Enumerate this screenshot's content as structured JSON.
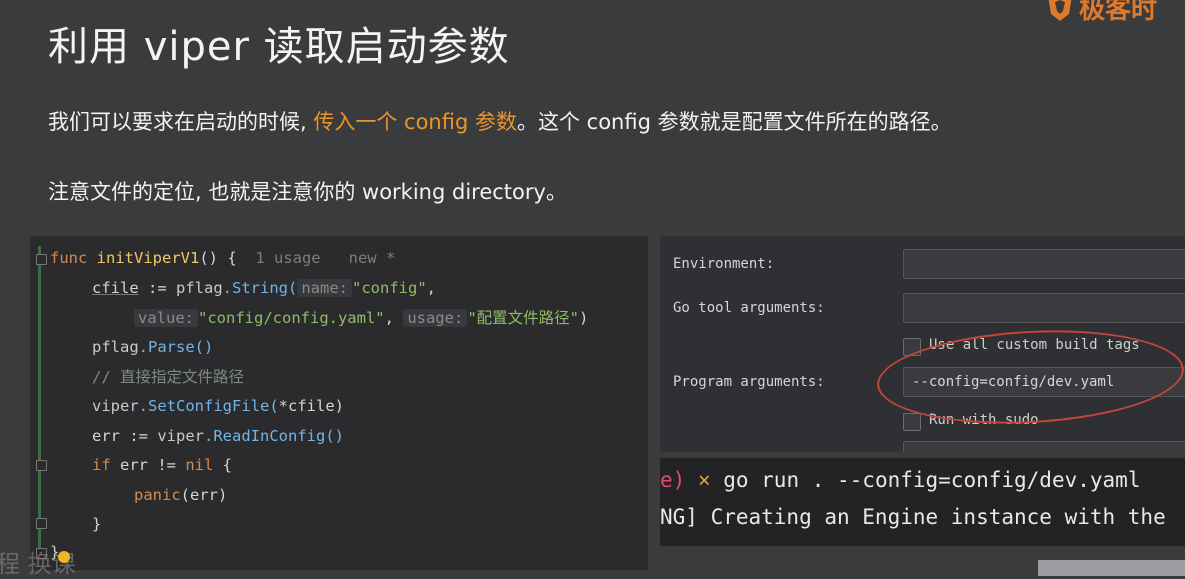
{
  "slide": {
    "title": "利用 viper 读取启动参数",
    "para1_before": "我们可以要求在启动的时候, ",
    "para1_highlight": "传入一个 config 参数",
    "para1_after": "。这个 config 参数就是配置文件所在的路径。",
    "para2": "注意文件的定位, 也就是注意你的 working directory。",
    "logo_text": "极客时"
  },
  "code": {
    "l1_kw": "func ",
    "l1_fn": "initViperV1",
    "l1_rest": "() {",
    "l1_meta": "  1 usage   new *",
    "l2_var": "cfile",
    "l2_op": " := ",
    "l2_pkg": "pflag",
    "l2_call": ".String(",
    "l2_hint": "name:",
    "l2_str": "\"config\"",
    "l2_end": ",",
    "l3_hint1": "value:",
    "l3_str1": "\"config/config.yaml\"",
    "l3_sep": ", ",
    "l3_hint2": "usage:",
    "l3_str2": "\"配置文件路径\"",
    "l3_end": ")",
    "l4_pkg": "pflag",
    "l4_call": ".Parse()",
    "l5_cmt": "// 直接指定文件路径",
    "l6_pkg": "viper",
    "l6_call": ".SetConfigFile(",
    "l6_arg": "*cfile)",
    "l7_a": "err := ",
    "l7_pkg": "viper",
    "l7_call": ".ReadInConfig()",
    "l8_kw": "if ",
    "l8_a": "err != ",
    "l8_nil": "nil",
    "l8_b": " {",
    "l9_kw": "panic",
    "l9_a": "(err)",
    "l10": "}",
    "l11": "}"
  },
  "run_config": {
    "environment_label": "Environment:",
    "go_tool_label": "Go tool arguments:",
    "custom_tags_label": "Use all custom build tags",
    "program_args_label": "Program arguments:",
    "program_args_value": "--config=config/dev.yaml",
    "sudo_label": "Run with sudo"
  },
  "terminal": {
    "line1_prefix": "e)",
    "line1_cross": " × ",
    "line1_cmd": "go run . --config=config/dev.yaml",
    "line2": "NG] Creating an Engine instance with the"
  },
  "watermark": "程 换课"
}
